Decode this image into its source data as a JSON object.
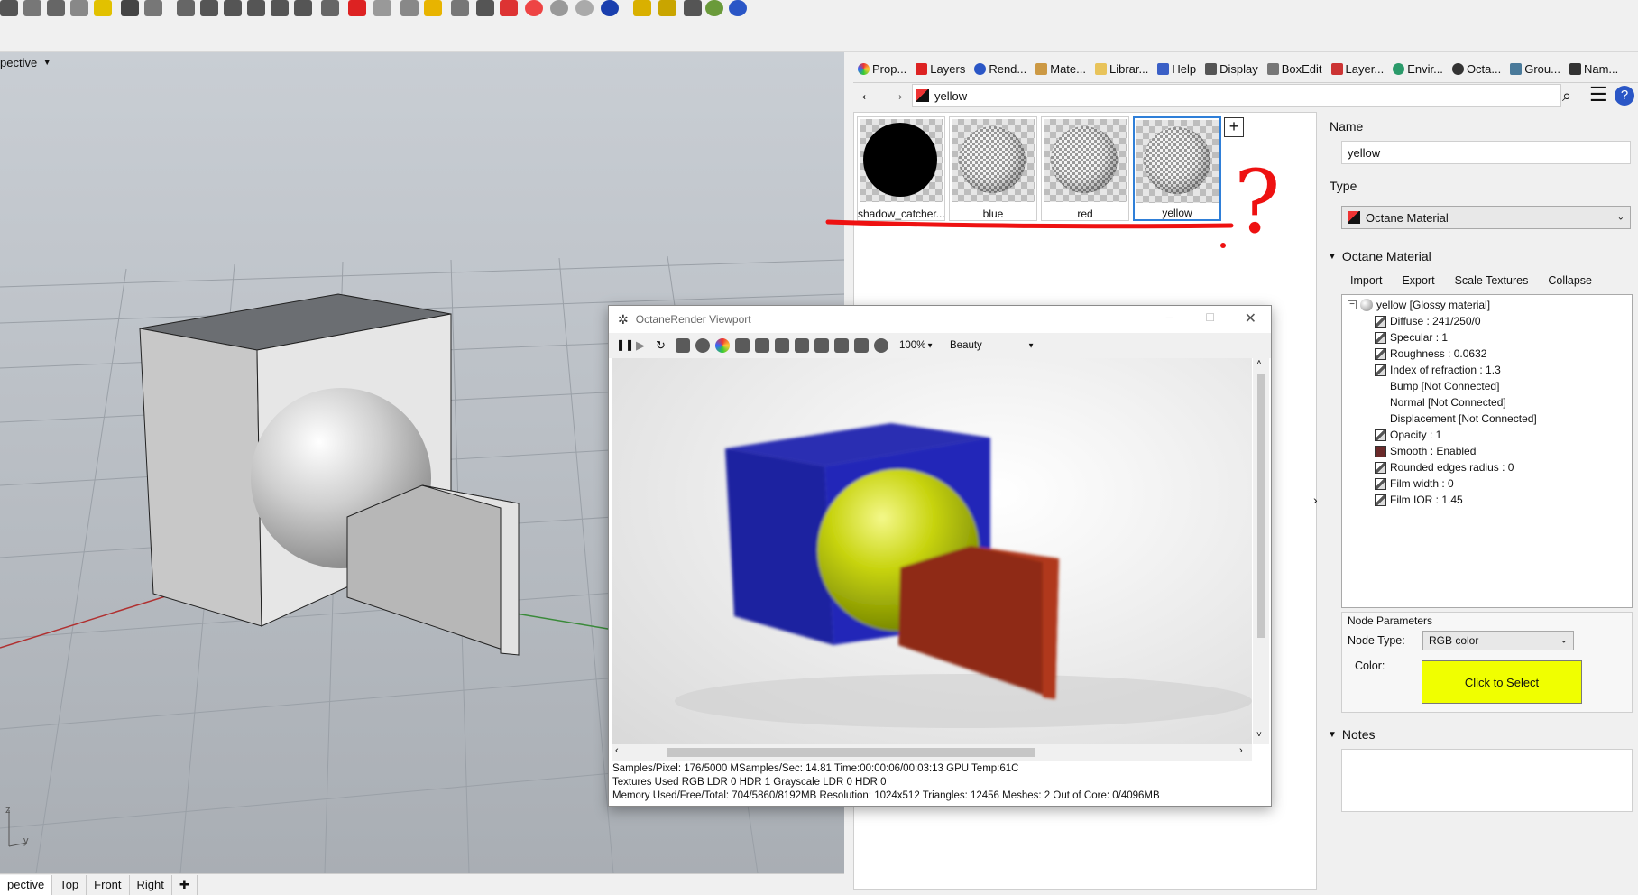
{
  "viewport": {
    "title": "pective",
    "tabs": [
      "pective",
      "Top",
      "Front",
      "Right"
    ],
    "axis_z": "z",
    "axis_y": "y"
  },
  "panel_tabs": [
    "Prop...",
    "Layers",
    "Rend...",
    "Mate...",
    "Librar...",
    "Help",
    "Display",
    "BoxEdit",
    "Layer...",
    "Envir...",
    "Octa...",
    "Grou...",
    "Nam..."
  ],
  "nav": {
    "path": "yellow"
  },
  "materials": [
    {
      "name": "shadow_catcher...",
      "kind": "black"
    },
    {
      "name": "blue",
      "kind": "checker"
    },
    {
      "name": "red",
      "kind": "checker"
    },
    {
      "name": "yellow",
      "kind": "checker",
      "selected": true
    }
  ],
  "annotation": "?",
  "properties": {
    "name_label": "Name",
    "name_value": "yellow",
    "type_label": "Type",
    "type_value": "Octane Material",
    "octane_section": "Octane Material",
    "actions": [
      "Import",
      "Export",
      "Scale Textures",
      "Collapse"
    ],
    "tree_root": "yellow  [Glossy material]",
    "tree_items": [
      "Diffuse : 241/250/0",
      "Specular : 1",
      "Roughness : 0.0632",
      "Index of refraction : 1.3",
      "Bump  [Not Connected]",
      "Normal  [Not Connected]",
      "Displacement  [Not Connected]",
      "Opacity : 1",
      "Smooth : Enabled",
      "Rounded edges radius : 0",
      "Film width : 0",
      "Film IOR : 1.45"
    ],
    "node_params_title": "Node Parameters",
    "node_type_label": "Node Type:",
    "node_type_value": "RGB color",
    "color_label": "Color:",
    "color_button": "Click to Select",
    "color_value": "#f1fa00",
    "notes_label": "Notes"
  },
  "octane_window": {
    "title": "OctaneRender Viewport",
    "zoom": "100%",
    "pass": "Beauty",
    "status_lines": [
      "Samples/Pixel: 176/5000   MSamples/Sec: 14.81   Time:00:00:06/00:03:13   GPU Temp:61C",
      "Textures Used RGB LDR 0   HDR 1   Grayscale LDR 0   HDR 0",
      "Memory Used/Free/Total: 704/5860/8192MB   Resolution: 1024x512   Triangles: 12456   Meshes: 2 Out of Core: 0/4096MB"
    ]
  }
}
